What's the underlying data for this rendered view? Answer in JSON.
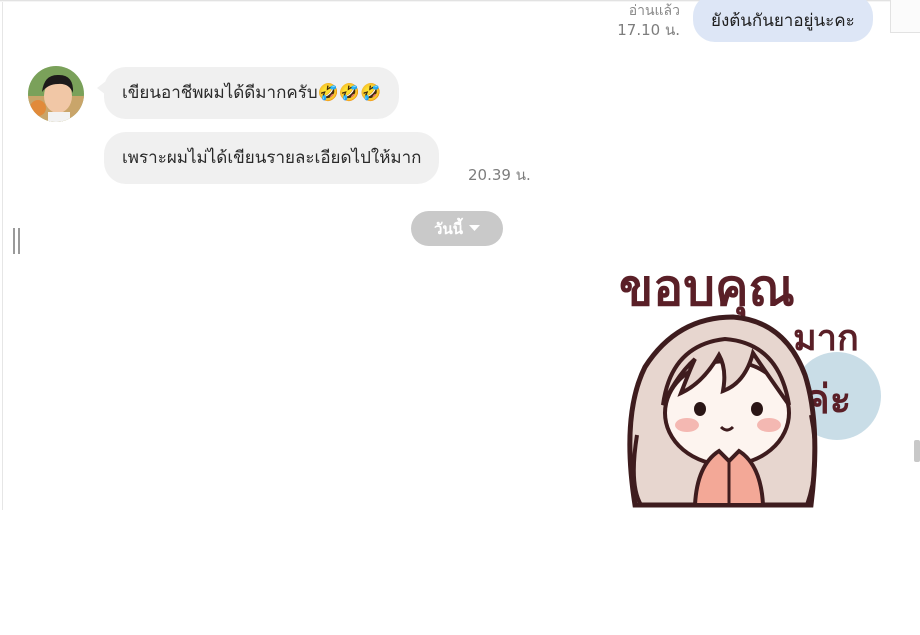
{
  "messages": {
    "outgoing_top": {
      "text": "ยังต้นกันยาอยู่นะคะ",
      "read_status": "อ่านแล้ว",
      "time": "17.10 น."
    },
    "incoming": [
      {
        "text": "เขียนอาชีพผมได้ดีมากครับ",
        "emojis": "🤣🤣🤣"
      },
      {
        "text": "เพราะผมไม่ได้เขียนรายละเอียดไปให้มาก",
        "time": "20.39 น."
      }
    ],
    "date_separator": {
      "label": "วันนี้"
    },
    "sticker": {
      "type": "thank-you-sticker",
      "text_line1": "ขอบคุณ",
      "text_line2": "มาก",
      "text_line3": "ค่ะ"
    }
  },
  "icons": {
    "avatar": "user-avatar",
    "date_dropdown": "chevron-down-icon",
    "resize": "drag-handle-icon"
  },
  "colors": {
    "outgoing_bubble": "#dde6f6",
    "incoming_bubble": "#f0f0f0",
    "date_chip": "#c9c9c9",
    "sticker_text": "#5a1f27"
  }
}
